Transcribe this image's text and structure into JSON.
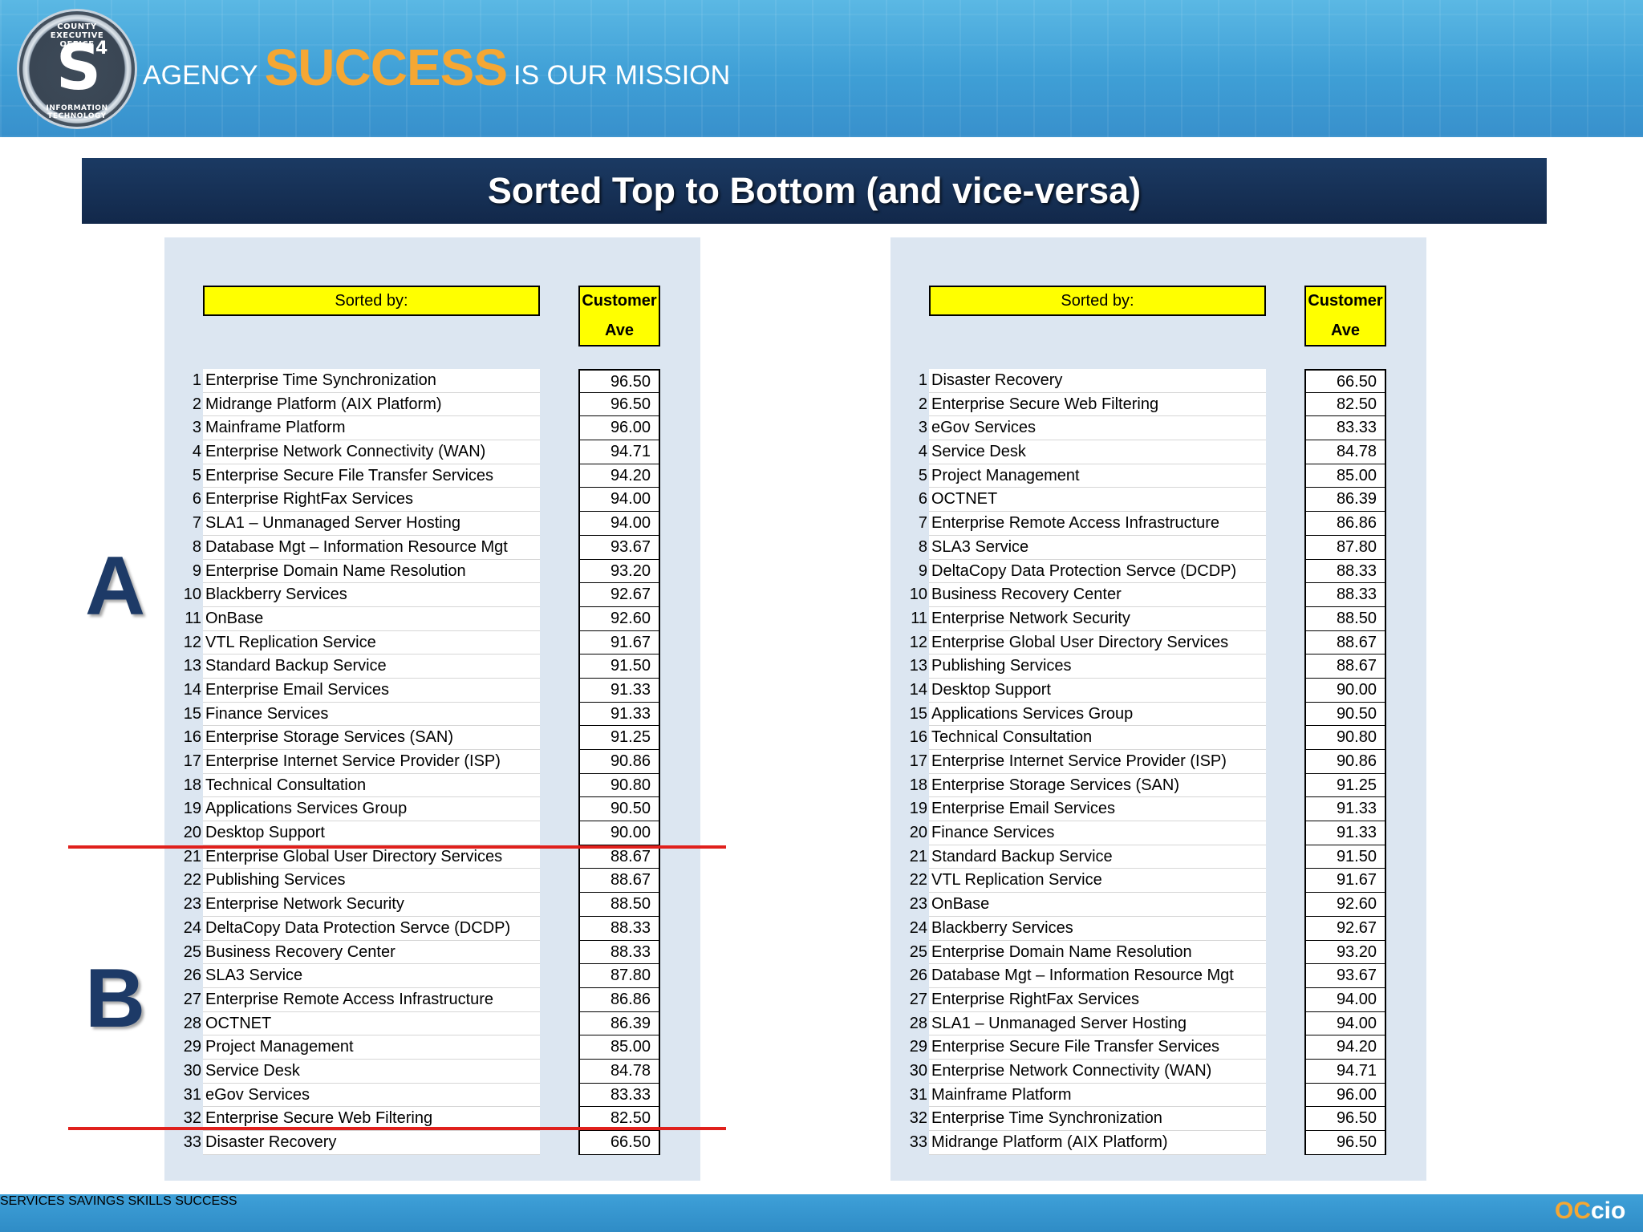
{
  "header": {
    "seal": {
      "letter": "S",
      "superscript": "4",
      "ring_top": "COUNTY EXECUTIVE OFFICE",
      "ring_bottom": "INFORMATION TECHNOLOGY"
    },
    "tagline": {
      "agency": "AGENCY",
      "success": "SUCCESS",
      "mission": "IS OUR MISSION"
    }
  },
  "title": "Sorted Top to Bottom (and vice-versa)",
  "markers": {
    "a": "A",
    "b": "B"
  },
  "left_table": {
    "sorted_by_label": "Sorted by:",
    "customer_header": [
      "Customer",
      "Ave"
    ],
    "rows": [
      {
        "rank": "1",
        "name": "Enterprise Time Synchronization",
        "value": "96.50"
      },
      {
        "rank": "2",
        "name": "Midrange Platform (AIX Platform)",
        "value": "96.50"
      },
      {
        "rank": "3",
        "name": "Mainframe Platform",
        "value": "96.00"
      },
      {
        "rank": "4",
        "name": "Enterprise Network Connectivity (WAN)",
        "value": "94.71"
      },
      {
        "rank": "5",
        "name": "Enterprise Secure File Transfer Services",
        "value": "94.20"
      },
      {
        "rank": "6",
        "name": "Enterprise RightFax Services",
        "value": "94.00"
      },
      {
        "rank": "7",
        "name": "SLA1 – Unmanaged Server Hosting",
        "value": "94.00"
      },
      {
        "rank": "8",
        "name": "Database Mgt – Information Resource Mgt",
        "value": "93.67"
      },
      {
        "rank": "9",
        "name": "Enterprise Domain Name Resolution",
        "value": "93.20"
      },
      {
        "rank": "10",
        "name": "Blackberry Services",
        "value": "92.67"
      },
      {
        "rank": "11",
        "name": "OnBase",
        "value": "92.60"
      },
      {
        "rank": "12",
        "name": "VTL Replication Service",
        "value": "91.67"
      },
      {
        "rank": "13",
        "name": "Standard Backup Service",
        "value": "91.50"
      },
      {
        "rank": "14",
        "name": "Enterprise Email Services",
        "value": "91.33"
      },
      {
        "rank": "15",
        "name": "Finance Services",
        "value": "91.33"
      },
      {
        "rank": "16",
        "name": "Enterprise Storage Services (SAN)",
        "value": "91.25"
      },
      {
        "rank": "17",
        "name": "Enterprise Internet Service Provider (ISP)",
        "value": "90.86"
      },
      {
        "rank": "18",
        "name": "Technical Consultation",
        "value": "90.80"
      },
      {
        "rank": "19",
        "name": "Applications Services Group",
        "value": "90.50"
      },
      {
        "rank": "20",
        "name": "Desktop Support",
        "value": "90.00"
      },
      {
        "rank": "21",
        "name": "Enterprise Global User Directory Services",
        "value": "88.67"
      },
      {
        "rank": "22",
        "name": "Publishing Services",
        "value": "88.67"
      },
      {
        "rank": "23",
        "name": "Enterprise Network Security",
        "value": "88.50"
      },
      {
        "rank": "24",
        "name": "DeltaCopy Data Protection Servce (DCDP)",
        "value": "88.33"
      },
      {
        "rank": "25",
        "name": "Business Recovery Center",
        "value": "88.33"
      },
      {
        "rank": "26",
        "name": "SLA3 Service",
        "value": "87.80"
      },
      {
        "rank": "27",
        "name": "Enterprise Remote Access Infrastructure",
        "value": "86.86"
      },
      {
        "rank": "28",
        "name": "OCTNET",
        "value": "86.39"
      },
      {
        "rank": "29",
        "name": "Project Management",
        "value": "85.00"
      },
      {
        "rank": "30",
        "name": "Service Desk",
        "value": "84.78"
      },
      {
        "rank": "31",
        "name": "eGov Services",
        "value": "83.33"
      },
      {
        "rank": "32",
        "name": "Enterprise Secure Web Filtering",
        "value": "82.50"
      },
      {
        "rank": "33",
        "name": "Disaster Recovery",
        "value": "66.50"
      }
    ]
  },
  "right_table": {
    "sorted_by_label": "Sorted by:",
    "customer_header": [
      "Customer",
      "Ave"
    ],
    "rows": [
      {
        "rank": "1",
        "name": "Disaster Recovery",
        "value": "66.50"
      },
      {
        "rank": "2",
        "name": "Enterprise Secure Web Filtering",
        "value": "82.50"
      },
      {
        "rank": "3",
        "name": "eGov Services",
        "value": "83.33"
      },
      {
        "rank": "4",
        "name": "Service Desk",
        "value": "84.78"
      },
      {
        "rank": "5",
        "name": "Project Management",
        "value": "85.00"
      },
      {
        "rank": "6",
        "name": "OCTNET",
        "value": "86.39"
      },
      {
        "rank": "7",
        "name": "Enterprise Remote Access Infrastructure",
        "value": "86.86"
      },
      {
        "rank": "8",
        "name": "SLA3 Service",
        "value": "87.80"
      },
      {
        "rank": "9",
        "name": "DeltaCopy Data Protection Servce (DCDP)",
        "value": "88.33"
      },
      {
        "rank": "10",
        "name": "Business Recovery Center",
        "value": "88.33"
      },
      {
        "rank": "11",
        "name": "Enterprise Network Security",
        "value": "88.50"
      },
      {
        "rank": "12",
        "name": "Enterprise Global User Directory Services",
        "value": "88.67"
      },
      {
        "rank": "13",
        "name": "Publishing Services",
        "value": "88.67"
      },
      {
        "rank": "14",
        "name": "Desktop Support",
        "value": "90.00"
      },
      {
        "rank": "15",
        "name": "Applications Services Group",
        "value": "90.50"
      },
      {
        "rank": "16",
        "name": "Technical Consultation",
        "value": "90.80"
      },
      {
        "rank": "17",
        "name": "Enterprise Internet Service Provider (ISP)",
        "value": "90.86"
      },
      {
        "rank": "18",
        "name": "Enterprise Storage Services (SAN)",
        "value": "91.25"
      },
      {
        "rank": "19",
        "name": "Enterprise Email Services",
        "value": "91.33"
      },
      {
        "rank": "20",
        "name": "Finance Services",
        "value": "91.33"
      },
      {
        "rank": "21",
        "name": "Standard Backup Service",
        "value": "91.50"
      },
      {
        "rank": "22",
        "name": "VTL Replication Service",
        "value": "91.67"
      },
      {
        "rank": "23",
        "name": "OnBase",
        "value": "92.60"
      },
      {
        "rank": "24",
        "name": "Blackberry Services",
        "value": "92.67"
      },
      {
        "rank": "25",
        "name": "Enterprise Domain Name Resolution",
        "value": "93.20"
      },
      {
        "rank": "26",
        "name": "Database Mgt – Information Resource Mgt",
        "value": "93.67"
      },
      {
        "rank": "27",
        "name": "Enterprise RightFax Services",
        "value": "94.00"
      },
      {
        "rank": "28",
        "name": "SLA1 – Unmanaged Server Hosting",
        "value": "94.00"
      },
      {
        "rank": "29",
        "name": "Enterprise Secure File Transfer Services",
        "value": "94.20"
      },
      {
        "rank": "30",
        "name": "Enterprise Network Connectivity (WAN)",
        "value": "94.71"
      },
      {
        "rank": "31",
        "name": "Mainframe Platform",
        "value": "96.00"
      },
      {
        "rank": "32",
        "name": "Enterprise Time Synchronization",
        "value": "96.50"
      },
      {
        "rank": "33",
        "name": "Midrange Platform (AIX Platform)",
        "value": "96.50"
      }
    ]
  },
  "footer": {
    "nav": [
      "SERVICES",
      "SAVINGS",
      "SKILLS",
      "SUCCESS"
    ],
    "logo": {
      "oc": "OC",
      "cio": "cio"
    }
  },
  "colors": {
    "banner_blue": "#3f9fd6",
    "title_navy": "#12284a",
    "panel_bg": "#dce6f1",
    "header_yellow": "#ffff00",
    "success_orange": "#f5a733",
    "marker_navy": "#1d3a67",
    "cut_line_red": "#e0201c"
  }
}
